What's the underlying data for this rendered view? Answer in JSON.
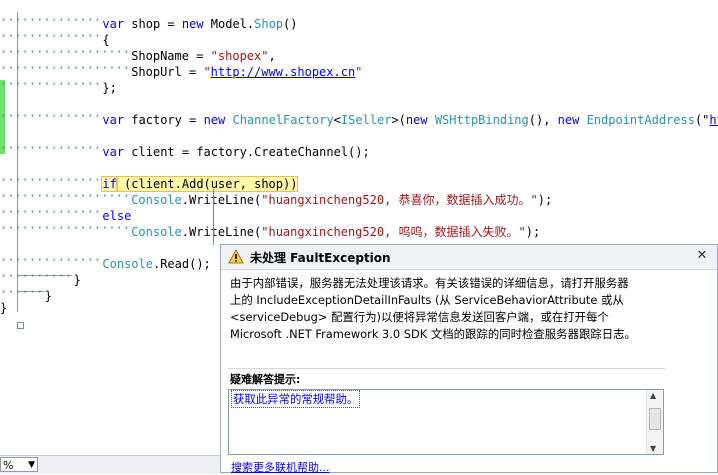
{
  "editor": {
    "lines": [
      {
        "indent": 12,
        "parts": [
          [
            "kw",
            "var"
          ],
          [
            "t",
            " shop = "
          ],
          [
            "kw",
            "new"
          ],
          [
            "t",
            " Model."
          ],
          [
            "ty",
            "Shop"
          ],
          [
            "t",
            "()"
          ]
        ]
      },
      {
        "indent": 12,
        "parts": [
          [
            "t",
            "{"
          ]
        ]
      },
      {
        "indent": 16,
        "parts": [
          [
            "t",
            "ShopName = "
          ],
          [
            "str",
            "\"shopex\""
          ],
          [
            "t",
            ","
          ]
        ]
      },
      {
        "indent": 16,
        "parts": [
          [
            "t",
            "ShopUrl = "
          ],
          [
            "str",
            "\""
          ],
          [
            "link",
            "http://www.shopex.cn"
          ],
          [
            "str",
            "\""
          ]
        ]
      },
      {
        "indent": 12,
        "parts": [
          [
            "t",
            "};"
          ]
        ]
      },
      {
        "indent": 0,
        "parts": []
      },
      {
        "indent": 12,
        "parts": [
          [
            "kw",
            "var"
          ],
          [
            "t",
            " factory = "
          ],
          [
            "kw",
            "new"
          ],
          [
            "t",
            " "
          ],
          [
            "ty",
            "ChannelFactory"
          ],
          [
            "t",
            "<"
          ],
          [
            "ty",
            "ISeller"
          ],
          [
            "t",
            ">("
          ],
          [
            "kw",
            "new"
          ],
          [
            "t",
            " "
          ],
          [
            "ty",
            "WSHttpBinding"
          ],
          [
            "t",
            "(), "
          ],
          [
            "kw",
            "new"
          ],
          [
            "t",
            " "
          ],
          [
            "ty",
            "EndpointAddress"
          ],
          [
            "t",
            "(\""
          ],
          [
            "link",
            "http"
          ]
        ]
      },
      {
        "indent": 0,
        "parts": []
      },
      {
        "indent": 12,
        "parts": [
          [
            "kw",
            "var"
          ],
          [
            "t",
            " client = factory.CreateChannel();"
          ]
        ]
      },
      {
        "indent": 0,
        "parts": []
      },
      {
        "indent": 12,
        "parts": [
          [
            "hlkw",
            "if"
          ],
          [
            "hl",
            " (client.Add(user, shop))"
          ]
        ]
      },
      {
        "indent": 16,
        "parts": [
          [
            "ty",
            "Console"
          ],
          [
            "t",
            "."
          ],
          [
            "t",
            "WriteLine("
          ],
          [
            "str",
            "\"huangxincheng520, 恭喜你，数据插入成功。\""
          ],
          [
            "t",
            ");"
          ]
        ]
      },
      {
        "indent": 12,
        "parts": [
          [
            "kw",
            "else"
          ]
        ]
      },
      {
        "indent": 16,
        "parts": [
          [
            "ty",
            "Console"
          ],
          [
            "t",
            "."
          ],
          [
            "t",
            "WriteLine("
          ],
          [
            "str",
            "\"huangxincheng520, 呜呜，数据插入失败。\""
          ],
          [
            "t",
            ");"
          ]
        ]
      },
      {
        "indent": 0,
        "parts": []
      },
      {
        "indent": 12,
        "parts": [
          [
            "ty",
            "Console"
          ],
          [
            "t",
            ".Read();"
          ]
        ]
      },
      {
        "indent": 8,
        "parts": [
          [
            "t",
            "}"
          ]
        ]
      },
      {
        "indent": 4,
        "parts": [
          [
            "t",
            "}"
          ]
        ]
      },
      {
        "indent": 0,
        "parts": [
          [
            "t",
            "}"
          ]
        ]
      }
    ]
  },
  "status": {
    "zoom": "%"
  },
  "exception": {
    "title": "未处理 FaultException",
    "message_lines": [
      "由于内部错误，服务器无法处理该请求。有关该错误的详细信息，请打开服务器",
      "上的 IncludeExceptionDetailInFaults (从 ServiceBehaviorAttribute 或从",
      "<serviceDebug> 配置行为)以便将异常信息发送回客户端，或在打开每个",
      "Microsoft .NET Framework 3.0 SDK 文档的跟踪的同时检查服务器跟踪日志。"
    ],
    "tips_label": "疑难解答提示:",
    "tips_link": "获取此异常的常规帮助。",
    "more_link": "搜索更多联机帮助...",
    "close_glyph": "✕"
  },
  "colors": {
    "keyword": "#0000ff",
    "type": "#2b91af",
    "string": "#a31515",
    "highlight": "#fff8a8",
    "change_bar": "#6ee06e"
  }
}
